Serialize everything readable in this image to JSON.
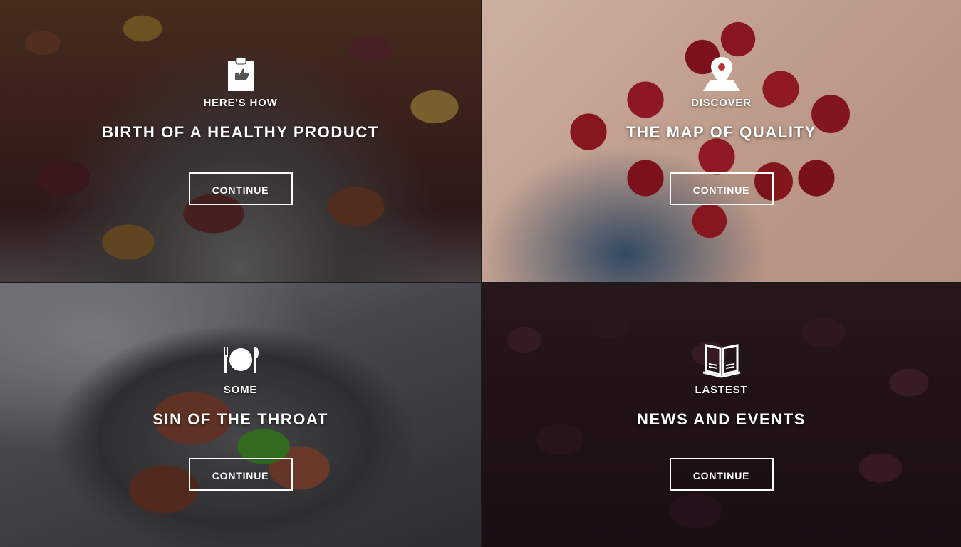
{
  "tiles": [
    {
      "kicker": "HERE'S HOW",
      "title": "BIRTH OF A HEALTHY PRODUCT",
      "button": "CONTINUE",
      "icon": "clipboard-thumbs-up-icon"
    },
    {
      "kicker": "DISCOVER",
      "title": "THE MAP OF QUALITY",
      "button": "CONTINUE",
      "icon": "map-pin-icon"
    },
    {
      "kicker": "SOME",
      "title": "SIN OF THE THROAT",
      "button": "CONTINUE",
      "icon": "plate-cutlery-icon"
    },
    {
      "kicker": "LASTEST",
      "title": "NEWS AND EVENTS",
      "button": "CONTINUE",
      "icon": "open-book-icon"
    }
  ],
  "colors": {
    "text": "#ffffff",
    "button_border": "#ffffff"
  }
}
